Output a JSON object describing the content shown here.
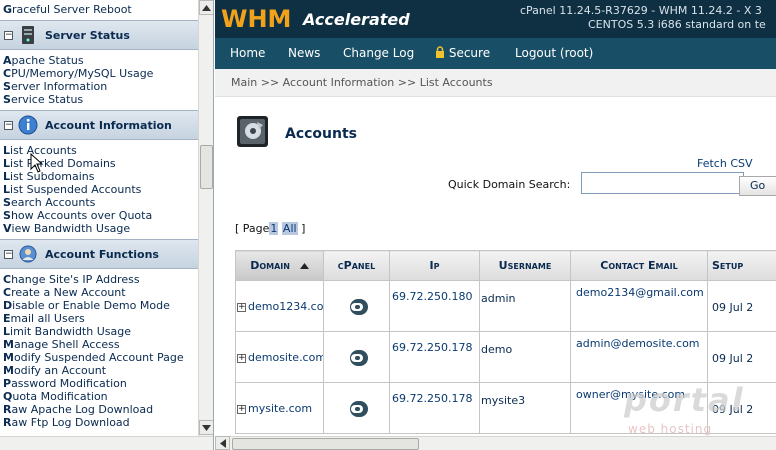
{
  "sidebar": {
    "top_links": [
      "Graceful Server Reboot"
    ],
    "sections": [
      {
        "title": "Server Status",
        "icon": "server-icon",
        "links": [
          "Apache Status",
          "CPU/Memory/MySQL Usage",
          "Server Information",
          "Service Status"
        ]
      },
      {
        "title": "Account Information",
        "icon": "info-icon",
        "links": [
          "List Accounts",
          "List Parked Domains",
          "List Subdomains",
          "List Suspended Accounts",
          "Search Accounts",
          "Show Accounts over Quota",
          "View Bandwidth Usage"
        ]
      },
      {
        "title": "Account Functions",
        "icon": "account-functions-icon",
        "links": [
          "Change Site's IP Address",
          "Create a New Account",
          "Disable or Enable Demo Mode",
          "Email all Users",
          "Limit Bandwidth Usage",
          "Manage Shell Access",
          "Modify Suspended Account Page",
          "Modify an Account",
          "Password Modification",
          "Quota Modification",
          "Raw Apache Log Download",
          "Raw Ftp Log Download"
        ]
      }
    ]
  },
  "header": {
    "logo_main": "WHM",
    "logo_sub": "Accelerated",
    "version_line1": "cPanel 11.24.5-R37629 - WHM 11.24.2 - X 3",
    "version_line2": "CENTOS 5.3 i686 standard on te",
    "colors": {
      "topbar": "#0e3042",
      "navbar": "#184e66",
      "logo": "#f2a11b"
    }
  },
  "nav": {
    "home": "Home",
    "news": "News",
    "changelog": "Change Log",
    "secure": "Secure",
    "logout": "Logout (root)"
  },
  "breadcrumb": "Main >> Account Information >> List Accounts",
  "page": {
    "title": "Accounts",
    "fetch_csv": "Fetch CSV",
    "search_label": "Quick Domain Search:",
    "search_value": "",
    "go_label": "Go",
    "pager": {
      "prefix": "[ Page",
      "page": "1",
      "all": "All",
      "suffix": "]"
    }
  },
  "table": {
    "columns": [
      "Domain",
      "cPanel",
      "Ip",
      "Username",
      "Contact Email",
      "Setup"
    ],
    "rows": [
      {
        "expander": "+",
        "domain": "demo1234.com",
        "ip": "69.72.250.180",
        "username": "admin",
        "email": "demo2134@gmail.com",
        "setup": "09 Jul 2"
      },
      {
        "expander": "+",
        "domain": "demosite.com",
        "ip": "69.72.250.178",
        "username": "demo",
        "email": "admin@demosite.com",
        "setup": "09 Jul 2"
      },
      {
        "expander": "+",
        "domain": "mysite.com",
        "ip": "69.72.250.178",
        "username": "mysite3",
        "email": "owner@mysite.com",
        "setup": "09 Jul 2"
      }
    ]
  },
  "watermark": {
    "main": "portal",
    "sub": "web hosting"
  }
}
